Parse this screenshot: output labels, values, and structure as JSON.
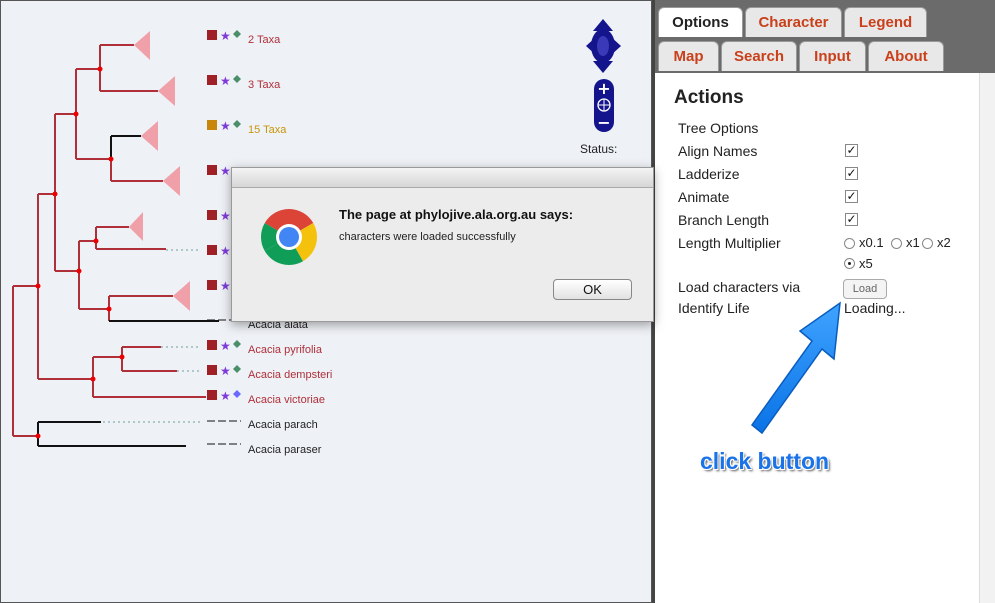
{
  "tabs": {
    "row1": [
      "Options",
      "Character",
      "Legend"
    ],
    "row2": [
      "Map",
      "Search",
      "Input",
      "About"
    ],
    "active": "Options"
  },
  "actions": {
    "title": "Actions",
    "tree_options": "Tree Options",
    "align_names": "Align Names",
    "ladderize": "Ladderize",
    "animate": "Animate",
    "branch_length": "Branch Length",
    "length_multiplier": "Length Multiplier",
    "multipliers": [
      "x0.1",
      "x1",
      "x2",
      "x5"
    ],
    "multiplier_selected": "x5",
    "load_characters": "Load characters via",
    "load_button": "Load",
    "identify_life": "Identify Life",
    "identify_status": "Loading..."
  },
  "annotation": {
    "text": "click button"
  },
  "tree": {
    "status_label": "Status:",
    "taxa": [
      {
        "label": "2 Taxa",
        "color": "#b0303a"
      },
      {
        "label": "3 Taxa",
        "color": "#b0303a"
      },
      {
        "label": "15 Taxa",
        "color": "#c8960a"
      },
      {
        "label": "Acacia alata",
        "color": "#222222"
      },
      {
        "label": "Acacia pyrifolia",
        "color": "#b0303a"
      },
      {
        "label": "Acacia dempsteri",
        "color": "#b0303a"
      },
      {
        "label": "Acacia victoriae",
        "color": "#b0303a"
      },
      {
        "label": "Acacia parach",
        "color": "#222222"
      },
      {
        "label": "Acacia paraser",
        "color": "#222222"
      }
    ]
  },
  "dialog": {
    "title": "The page at phylojive.ala.org.au says:",
    "message": "characters were loaded successfully",
    "ok_label": "OK"
  },
  "colors": {
    "tab_text": "#c9401b",
    "branch_red": "#b0303a",
    "nav_blue": "#14148c",
    "arrow_blue": "#1a8cff"
  }
}
